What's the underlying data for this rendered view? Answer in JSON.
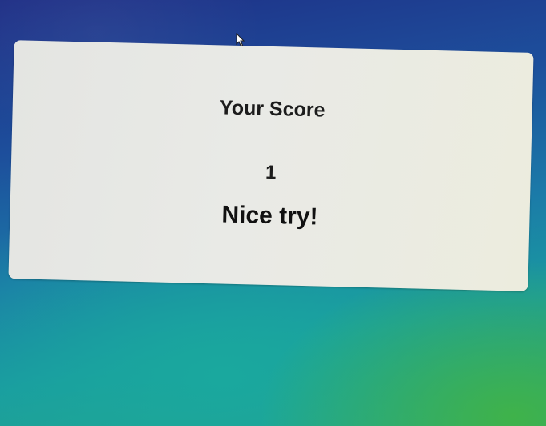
{
  "score_dialog": {
    "title": "Your Score",
    "score": "1",
    "message": "Nice try!"
  },
  "desktop": {
    "cursor_icon": "arrow-cursor-icon",
    "colors": {
      "background_top": "#1f2f86",
      "background_mid": "#1b7aa8",
      "background_bottom_right": "#3fb24a",
      "dialog_background": "#e9eae6",
      "text": "#1c1c1c"
    }
  }
}
